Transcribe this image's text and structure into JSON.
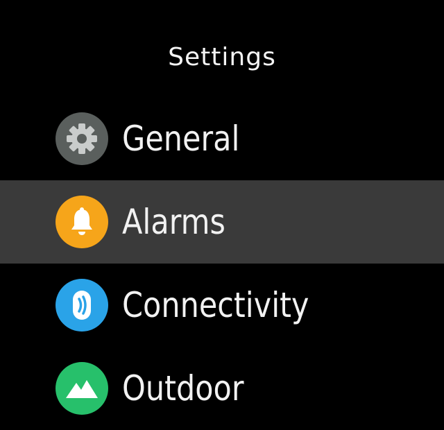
{
  "screen": {
    "title": "Settings"
  },
  "menu": {
    "items": [
      {
        "label": "General",
        "icon": "gear-icon",
        "color": "#5a5f5d",
        "selected": false
      },
      {
        "label": "Alarms",
        "icon": "bell-icon",
        "color": "#f6a51a",
        "selected": true
      },
      {
        "label": "Connectivity",
        "icon": "connectivity-icon",
        "color": "#2aa3e8",
        "selected": false
      },
      {
        "label": "Outdoor",
        "icon": "mountain-icon",
        "color": "#27c06b",
        "selected": false
      }
    ]
  }
}
